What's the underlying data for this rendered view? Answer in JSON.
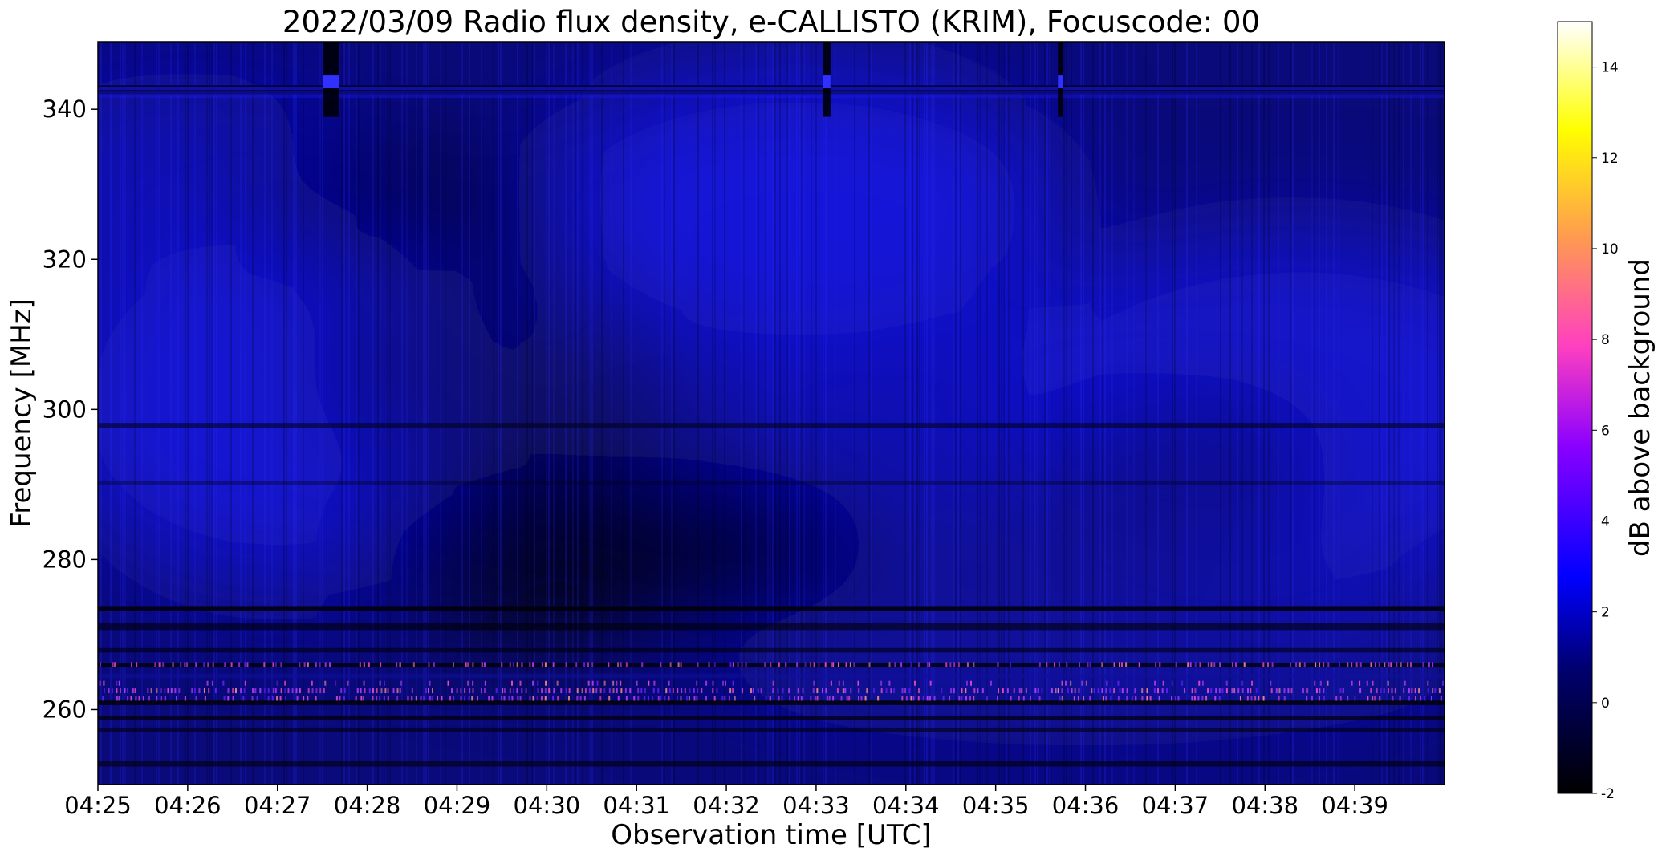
{
  "chart_data": {
    "type": "heatmap",
    "title": "2022/03/09  Radio flux density, e-CALLISTO (KRIM), Focuscode: 00",
    "xlabel": "Observation time [UTC]",
    "ylabel": "Frequency [MHz]",
    "x_ticks": [
      "04:25",
      "04:26",
      "04:27",
      "04:28",
      "04:29",
      "04:30",
      "04:31",
      "04:32",
      "04:33",
      "04:34",
      "04:35",
      "04:36",
      "04:37",
      "04:38",
      "04:39"
    ],
    "x_range_minutes": [
      0,
      15
    ],
    "y_ticks": [
      260,
      280,
      300,
      320,
      340
    ],
    "ylim": [
      250,
      349
    ],
    "colorbar": {
      "label": "dB above background",
      "range": [
        -2,
        15
      ],
      "ticks": [
        -2,
        0,
        2,
        4,
        6,
        8,
        10,
        12,
        14
      ],
      "colormap": "gnuplot2",
      "colors": [
        "#000000",
        "#0000ff",
        "#8a00ff",
        "#ff5ca0",
        "#ffb040",
        "#ffff00",
        "#ffffff"
      ]
    },
    "features": [
      {
        "label": "persistent narrow-band interference",
        "freq_mhz": [
          343,
          342
        ]
      },
      {
        "label": "brighter interference lines",
        "freq_mhz": [
          266,
          262,
          261
        ]
      },
      {
        "label": "short vertical spikes",
        "time_utc": [
          "04:27:36",
          "04:33:07",
          "04:35:43"
        ]
      }
    ]
  }
}
